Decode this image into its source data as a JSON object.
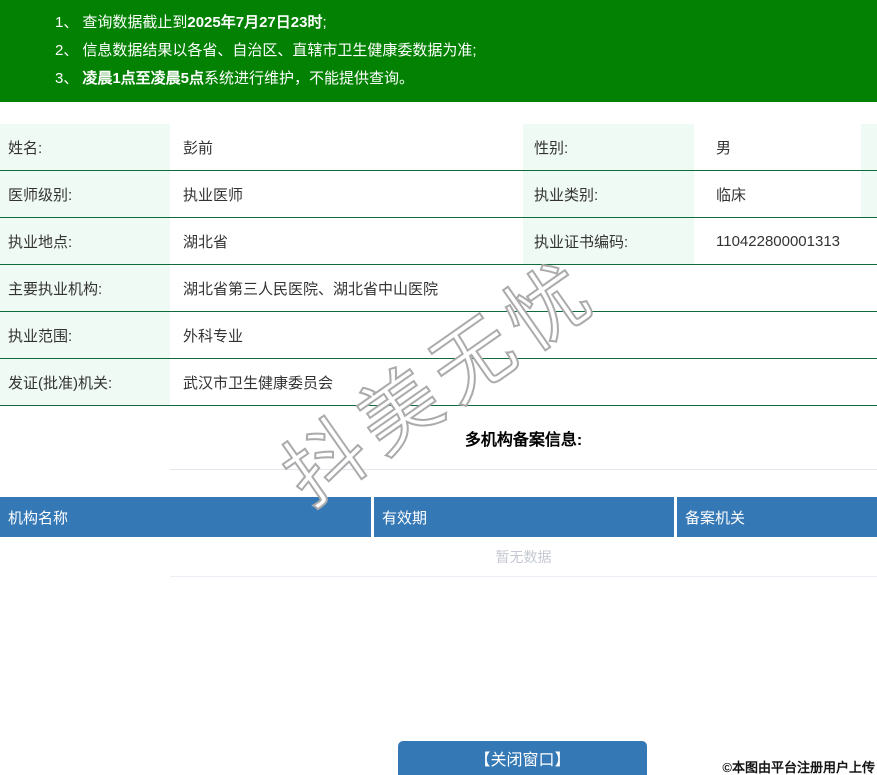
{
  "notice": {
    "items": [
      {
        "num": "1、",
        "pre": "查询数据截止到",
        "bold": "2025年7月27日23时",
        "suf": ";"
      },
      {
        "num": "2、",
        "pre": "信息数据结果以各省、自治区、直辖市卫生健康委数据为准;",
        "bold": "",
        "suf": ""
      },
      {
        "num": "3、",
        "pre": "",
        "bold": "凌晨1点至凌晨5点",
        "suf": "系统进行维护，不能提供查询。"
      }
    ]
  },
  "profile": {
    "name_label": "姓名:",
    "name": "彭前",
    "gender_label": "性别:",
    "gender": "男",
    "level_label": "医师级别:",
    "level": "执业医师",
    "category_label": "执业类别:",
    "category": "临床",
    "location_label": "执业地点:",
    "location": "湖北省",
    "cert_label": "执业证书编码:",
    "cert_no": "110422800001313",
    "main_org_label": "主要执业机构:",
    "main_org": "湖北省第三人民医院、湖北省中山医院",
    "scope_label": "执业范围:",
    "scope": "外科专业",
    "issuer_label": "发证(批准)机关:",
    "issuer": "武汉市卫生健康委员会"
  },
  "filing": {
    "section_title": "多机构备案信息:",
    "columns": [
      "机构名称",
      "有效期",
      "备案机关"
    ],
    "empty_text": "暂无数据"
  },
  "watermark": {
    "text": "抖美无忧"
  },
  "footer": {
    "close_button": "【关闭窗口】",
    "copyright": "©本图由平台注册用户上传"
  },
  "colors": {
    "banner_green": "#028102",
    "label_bg": "#f0faf4",
    "row_line": "#0f6b3c",
    "header_blue": "#3478b6",
    "button_blue": "#3478b6",
    "empty_gray": "#c4c9d1",
    "light_line": "#ebeef5",
    "section_line": "#e4e7ed",
    "text_color": "#333333"
  }
}
